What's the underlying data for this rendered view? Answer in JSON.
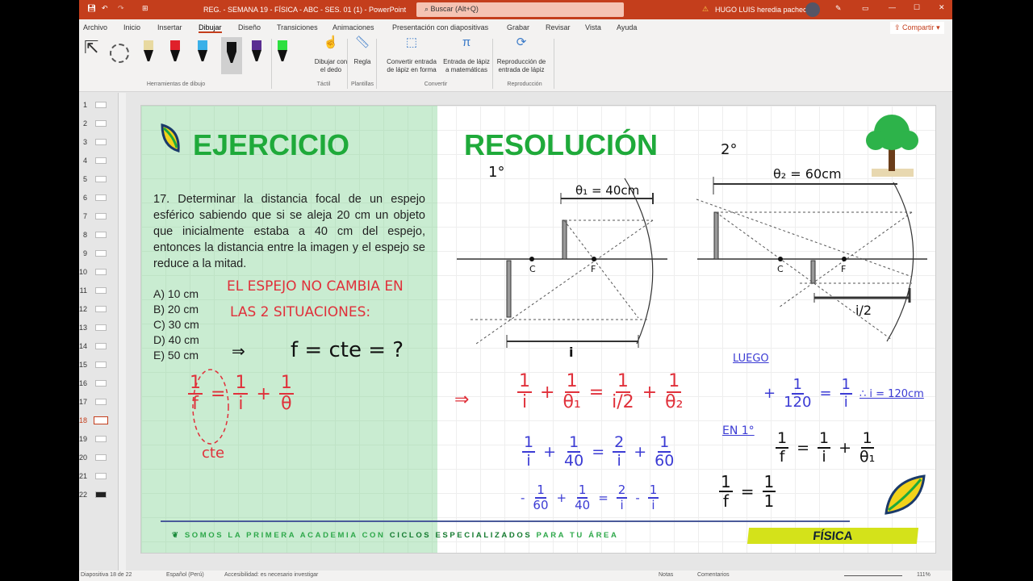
{
  "titlebar": {
    "doc_title": "REG. - SEMANA 19 - FÍSICA - ABC - SES. 01 (1)  -  PowerPoint",
    "search_placeholder": "Buscar (Alt+Q)",
    "user": "HUGO LUIS heredia pacheco"
  },
  "menu": [
    "Archivo",
    "Inicio",
    "Insertar",
    "Dibujar",
    "Diseño",
    "Transiciones",
    "Animaciones",
    "Presentación con diapositivas",
    "Grabar",
    "Revisar",
    "Vista",
    "Ayuda"
  ],
  "active_menu": "Dibujar",
  "share_label": "Compartir",
  "ribbon": {
    "pens": [
      {
        "color": "#e8d9a0"
      },
      {
        "color": "#e0202a"
      },
      {
        "color": "#3ab0e8"
      },
      {
        "color": "#111111"
      },
      {
        "color": "#5a2d91"
      },
      {
        "color": "#2ee040"
      }
    ],
    "buttons": [
      {
        "l1": "Dibujar con",
        "l2": "el dedo"
      },
      {
        "l1": "Regla",
        "l2": ""
      },
      {
        "l1": "Convertir entrada",
        "l2": "de lápiz en forma"
      },
      {
        "l1": "Entrada de lápiz",
        "l2": "a matemáticas"
      },
      {
        "l1": "Reproducción de",
        "l2": "entrada de lápiz"
      }
    ],
    "groups": [
      "Herramientas de dibujo",
      "Táctil",
      "Plantillas",
      "Convertir",
      "Reproducción"
    ]
  },
  "thumbnails": {
    "count": 22,
    "selected": 18
  },
  "slide": {
    "left_title": "EJERCICIO",
    "right_title": "RESOLUCIÓN",
    "problem": "17.  Determinar la distancia focal de un espejo esférico sabiendo que si se aleja 20 cm un objeto que inicialmente estaba a 40 cm del espejo, entonces la distancia entre la imagen y el espejo se reduce a la mitad.",
    "options": [
      "A) 10 cm",
      "B) 20 cm",
      "C) 30 cm",
      "D) 40 cm",
      "E) 50 cm"
    ],
    "footer_a": "SOMOS LA PRIMERA ACADEMIA CON ",
    "footer_b": "CICLOS ESPECIALIZADOS",
    "footer_c": " PARA TU ÁREA",
    "subject": "FÍSICA",
    "notes": {
      "n1": "EL ESPEJO NO CAMBIA EN",
      "n2": "LAS 2 SITUACIONES:",
      "arrow": "⇒",
      "fcte": "f = cte = ?",
      "cte": "cte",
      "arrow2": "⇒",
      "luego": "LUEGO",
      "en1": "EN 1°",
      "ans": "∴ i = 120cm"
    },
    "diagram": {
      "d1": "1°",
      "d2": "2°",
      "theta1": "θ₁ = 40cm",
      "theta2": "θ₂ = 60cm",
      "i": "i",
      "ihalf": "i/2",
      "C": "C",
      "F": "F"
    },
    "equations": {
      "e0": [
        {
          "n": "1",
          "d": "f"
        },
        "=",
        {
          "n": "1",
          "d": "i"
        },
        "+",
        {
          "n": "1",
          "d": "θ"
        }
      ],
      "e1": [
        {
          "n": "1",
          "d": "i"
        },
        "+",
        {
          "n": "1",
          "d": "θ₁"
        },
        "=",
        {
          "n": "1",
          "d": "i/2"
        },
        "+",
        {
          "n": "1",
          "d": "θ₂"
        }
      ],
      "e2": [
        {
          "n": "1",
          "d": "i"
        },
        "+",
        {
          "n": "1",
          "d": "40"
        },
        "=",
        {
          "n": "2",
          "d": "i"
        },
        "+",
        {
          "n": "1",
          "d": "60"
        }
      ],
      "e3": [
        "-",
        {
          "n": "1",
          "d": "60"
        },
        "+",
        {
          "n": "1",
          "d": "40"
        },
        "=",
        {
          "n": "2",
          "d": "i"
        },
        "-",
        {
          "n": "1",
          "d": "i"
        }
      ],
      "e4": [
        "+",
        {
          "n": "1",
          "d": "120"
        },
        "=",
        {
          "n": "1",
          "d": "i"
        }
      ],
      "e5": [
        {
          "n": "1",
          "d": "f"
        },
        "=",
        {
          "n": "1",
          "d": "i"
        },
        "+",
        {
          "n": "1",
          "d": "θ₁"
        }
      ],
      "e6": [
        {
          "n": "1",
          "d": "f"
        },
        "=",
        {
          "n": "1",
          "d": "1"
        }
      ]
    }
  },
  "status": {
    "slide": "Diapositiva 18 de 22",
    "lang": "Español (Perú)",
    "access": "Accesibilidad: es necesario investigar",
    "notes": "Notas",
    "comments": "Comentarios",
    "zoom": "111%"
  },
  "colors": {
    "titlebar": "#c43e1c",
    "green": "#1faa3a",
    "red": "#e0303a",
    "blue": "#3b3bd4",
    "subject_bar": "#d4e21a"
  }
}
